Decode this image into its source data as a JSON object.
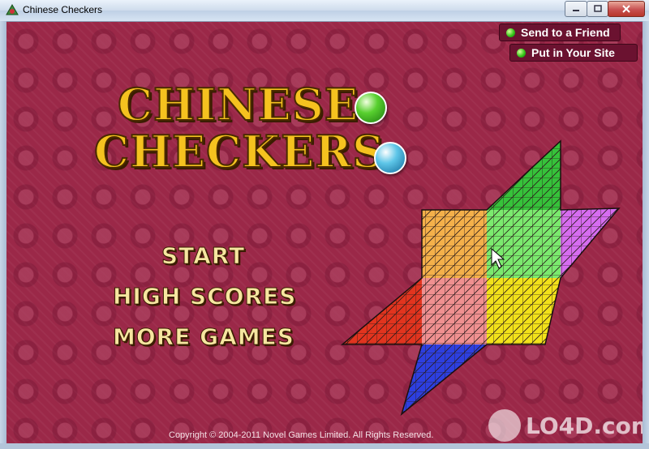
{
  "window": {
    "title": "Chinese Checkers"
  },
  "links": {
    "send_friend": "Send to a Friend",
    "put_site": "Put in Your Site"
  },
  "logo": {
    "line1": "CHINESE",
    "line2": "CHECKERS"
  },
  "menu": {
    "start": "START",
    "high_scores": "HIGH SCORES",
    "more_games": "MORE GAMES"
  },
  "copyright": "Copyright © 2004-2011 Novel Games Limited. All Rights Reserved.",
  "watermark": {
    "text": "LO4D.com"
  },
  "colors": {
    "background": "#9b2848",
    "logo_gold": "#f5c21f",
    "board_green": "#36c23a",
    "board_purple": "#c044e6",
    "board_yellow": "#f2e21a",
    "board_blue": "#2d3fe0",
    "board_red": "#e2341e",
    "board_orange": "#f09a1e"
  }
}
